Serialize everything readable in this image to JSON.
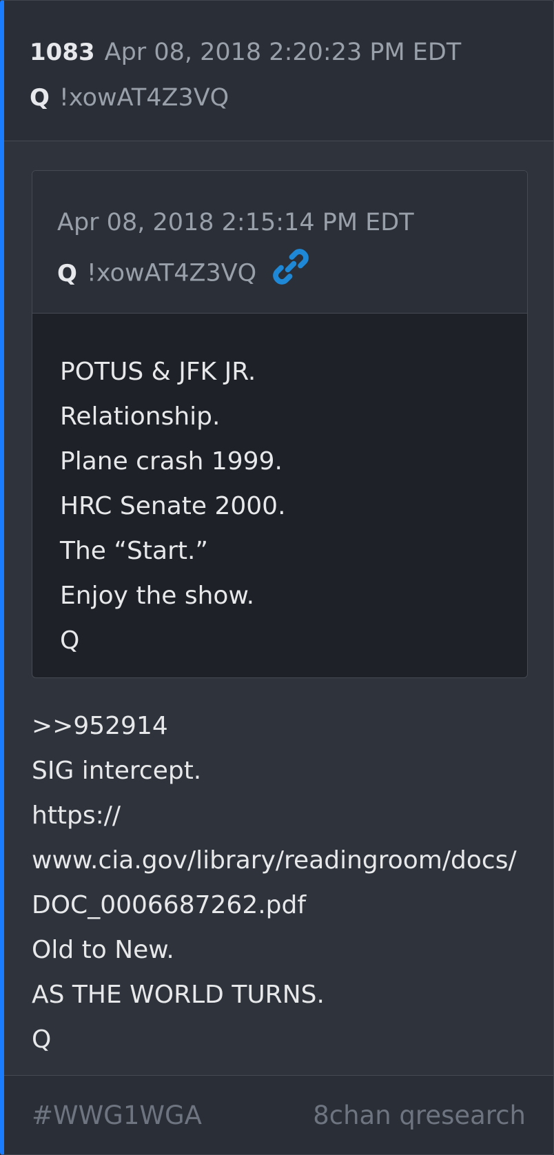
{
  "post": {
    "number": "1083",
    "date": "Apr 08, 2018 2:20:23 PM EDT",
    "author": "Q",
    "tripcode": "!xowAT4Z3VQ"
  },
  "quoted": {
    "date": "Apr 08, 2018 2:15:14 PM EDT",
    "author": "Q",
    "tripcode": "!xowAT4Z3VQ",
    "link_icon": "link-icon",
    "link_color": "#1e88d6",
    "lines": [
      "POTUS & JFK JR.",
      "Relationship.",
      "Plane crash 1999.",
      "HRC Senate 2000.",
      "The “Start.”",
      "Enjoy the show.",
      "Q"
    ]
  },
  "body": {
    "lines": [
      ">>952914",
      "SIG intercept.",
      "https://",
      "www.cia.gov/library/readingroom/docs/",
      "DOC_0006687262.pdf",
      "Old to New.",
      "AS THE WORLD TURNS.",
      "Q"
    ]
  },
  "footer": {
    "tag": "#WWG1WGA",
    "source": "8chan qresearch"
  },
  "colors": {
    "accent": "#1a7cff",
    "card_bg": "#2f333c",
    "quote_body_bg": "#1e2128",
    "text": "#e7e8ea",
    "muted": "#9aa0aa"
  }
}
